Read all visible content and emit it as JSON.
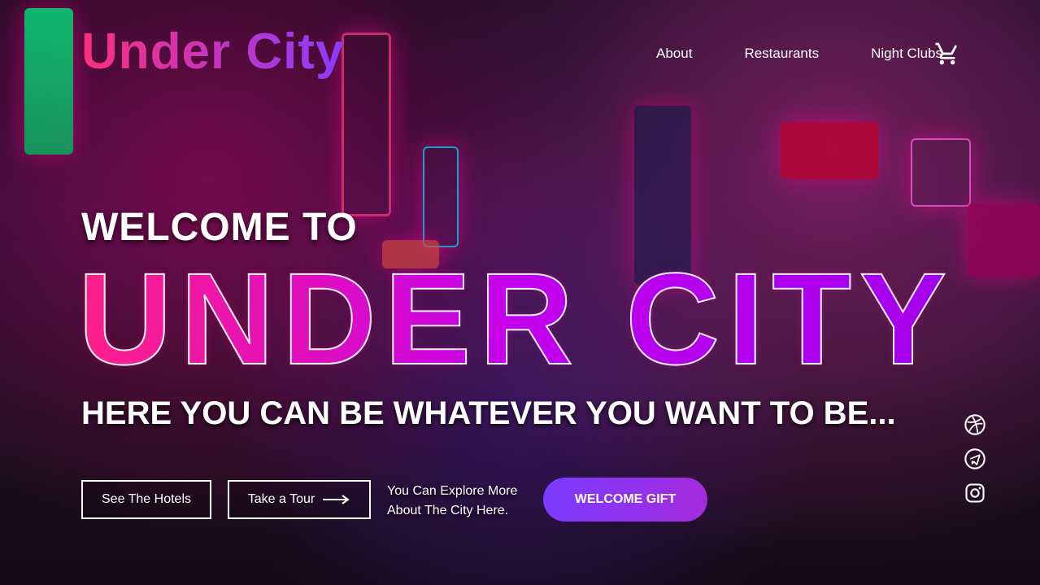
{
  "header": {
    "logo": "Under City",
    "nav": [
      "About",
      "Restaurants",
      "Night Clubs"
    ]
  },
  "hero": {
    "welcome": "WELCOME TO",
    "big_title": "UNDER CITY",
    "tagline": "HERE YOU CAN BE WHATEVER YOU WANT TO BE...",
    "explore_line1": "You Can Explore More",
    "explore_line2": "About The City Here."
  },
  "buttons": {
    "hotels": "See The Hotels",
    "tour": "Take a Tour",
    "gift": "WELCOME GIFT"
  },
  "colors": {
    "accent1": "#ff2f7b",
    "accent2": "#8b3bff"
  },
  "icons": {
    "cart": "cart-icon",
    "social": [
      "dribbble-icon",
      "telegram-icon",
      "instagram-icon"
    ]
  }
}
